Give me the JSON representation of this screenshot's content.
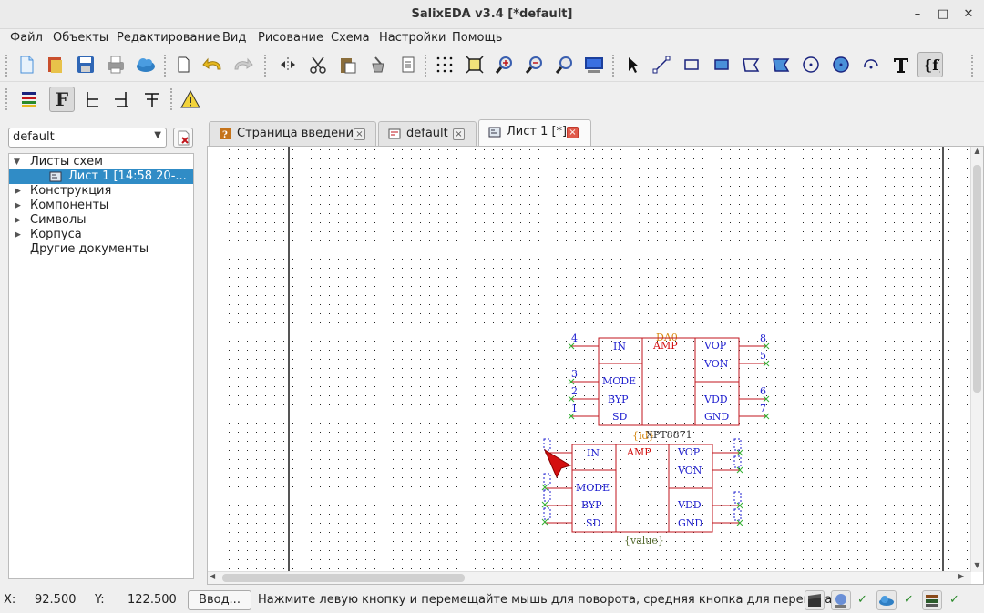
{
  "window": {
    "title": "SalixEDA v3.4 [*default]",
    "minimize": "–",
    "maximize": "□",
    "close": "✕"
  },
  "menu": [
    "Файл",
    "Объекты",
    "Редактирование",
    "Вид",
    "Рисование",
    "Схема",
    "Настройки",
    "Помощь"
  ],
  "toolbar": {
    "icons": [
      "new-file-icon",
      "open-project-icon",
      "save-icon",
      "print-icon",
      "cloud-icon",
      "new-page-icon",
      "undo-icon",
      "redo-icon",
      "mirror-icon",
      "cut-icon",
      "paste-icon",
      "clean-icon",
      "properties-icon",
      "grid-icon",
      "zoom-fit-icon",
      "zoom-in-icon",
      "zoom-out-icon",
      "zoom-region-icon",
      "monitor-icon",
      "select-icon",
      "line-icon",
      "rect-icon",
      "filled-rect-icon",
      "polygon-icon",
      "filled-polygon-icon",
      "circle-icon",
      "filled-circle-icon",
      "arc-icon",
      "text-icon",
      "field-icon"
    ],
    "row2": [
      "layers-icon",
      "field-text-icon",
      "align-left-icon",
      "align-center-icon",
      "align-top-icon",
      "warning-icon"
    ],
    "field_text_label": "F"
  },
  "sidebar": {
    "combo_value": "default",
    "tree": [
      {
        "label": "Листы схем",
        "level": 0,
        "expanded": true
      },
      {
        "label": "Лист 1 [14:58 20-...",
        "level": 1,
        "selected": true
      },
      {
        "label": "Конструкция",
        "level": 0,
        "expanded": false
      },
      {
        "label": "Компоненты",
        "level": 0,
        "expanded": false
      },
      {
        "label": "Символы",
        "level": 0,
        "expanded": false
      },
      {
        "label": "Корпуса",
        "level": 0,
        "expanded": false
      },
      {
        "label": "Другие документы",
        "level": 0,
        "leaf": true
      }
    ]
  },
  "tabs": [
    {
      "label": "Страница введения",
      "close": "×",
      "active": false
    },
    {
      "label": "default",
      "close": "×",
      "active": false
    },
    {
      "label": "Лист 1 [*]",
      "close": "×",
      "active": true
    }
  ],
  "schematic": {
    "component1": {
      "ref": "DA0",
      "type": "AMP",
      "left_pins": [
        {
          "num": "4",
          "name": "IN"
        },
        {
          "num": "3",
          "name": "MODE"
        },
        {
          "num": "2",
          "name": "BYP"
        },
        {
          "num": "1",
          "name": "SD"
        }
      ],
      "right_pins": [
        {
          "num": "8",
          "name": "VOP"
        },
        {
          "num": "5",
          "name": "VON"
        },
        {
          "num": "6",
          "name": "VDD"
        },
        {
          "num": "7",
          "name": "GND"
        }
      ],
      "part": "XPT8871"
    },
    "component2": {
      "ref": "{id}",
      "type": "AMP",
      "left_pins": [
        "IN",
        "MODE",
        "BYP",
        "SD"
      ],
      "right_pins": [
        "VOP",
        "VON",
        "VDD",
        "GND"
      ],
      "value": "{value}"
    },
    "colors": {
      "body": "#c0161c",
      "pin_name": "#2020d0",
      "ref": "#d88a14",
      "pin_num": "#2020d0",
      "cross": "#30b030",
      "value": "#556b2f"
    }
  },
  "status": {
    "x_label": "X:",
    "x_value": "92.500",
    "y_label": "Y:",
    "y_value": "122.500",
    "input_button": "Ввод...",
    "message": "Нажмите левую кнопку и перемещайте мышь для поворота, средняя кнопка для переноса",
    "check": "✓"
  }
}
